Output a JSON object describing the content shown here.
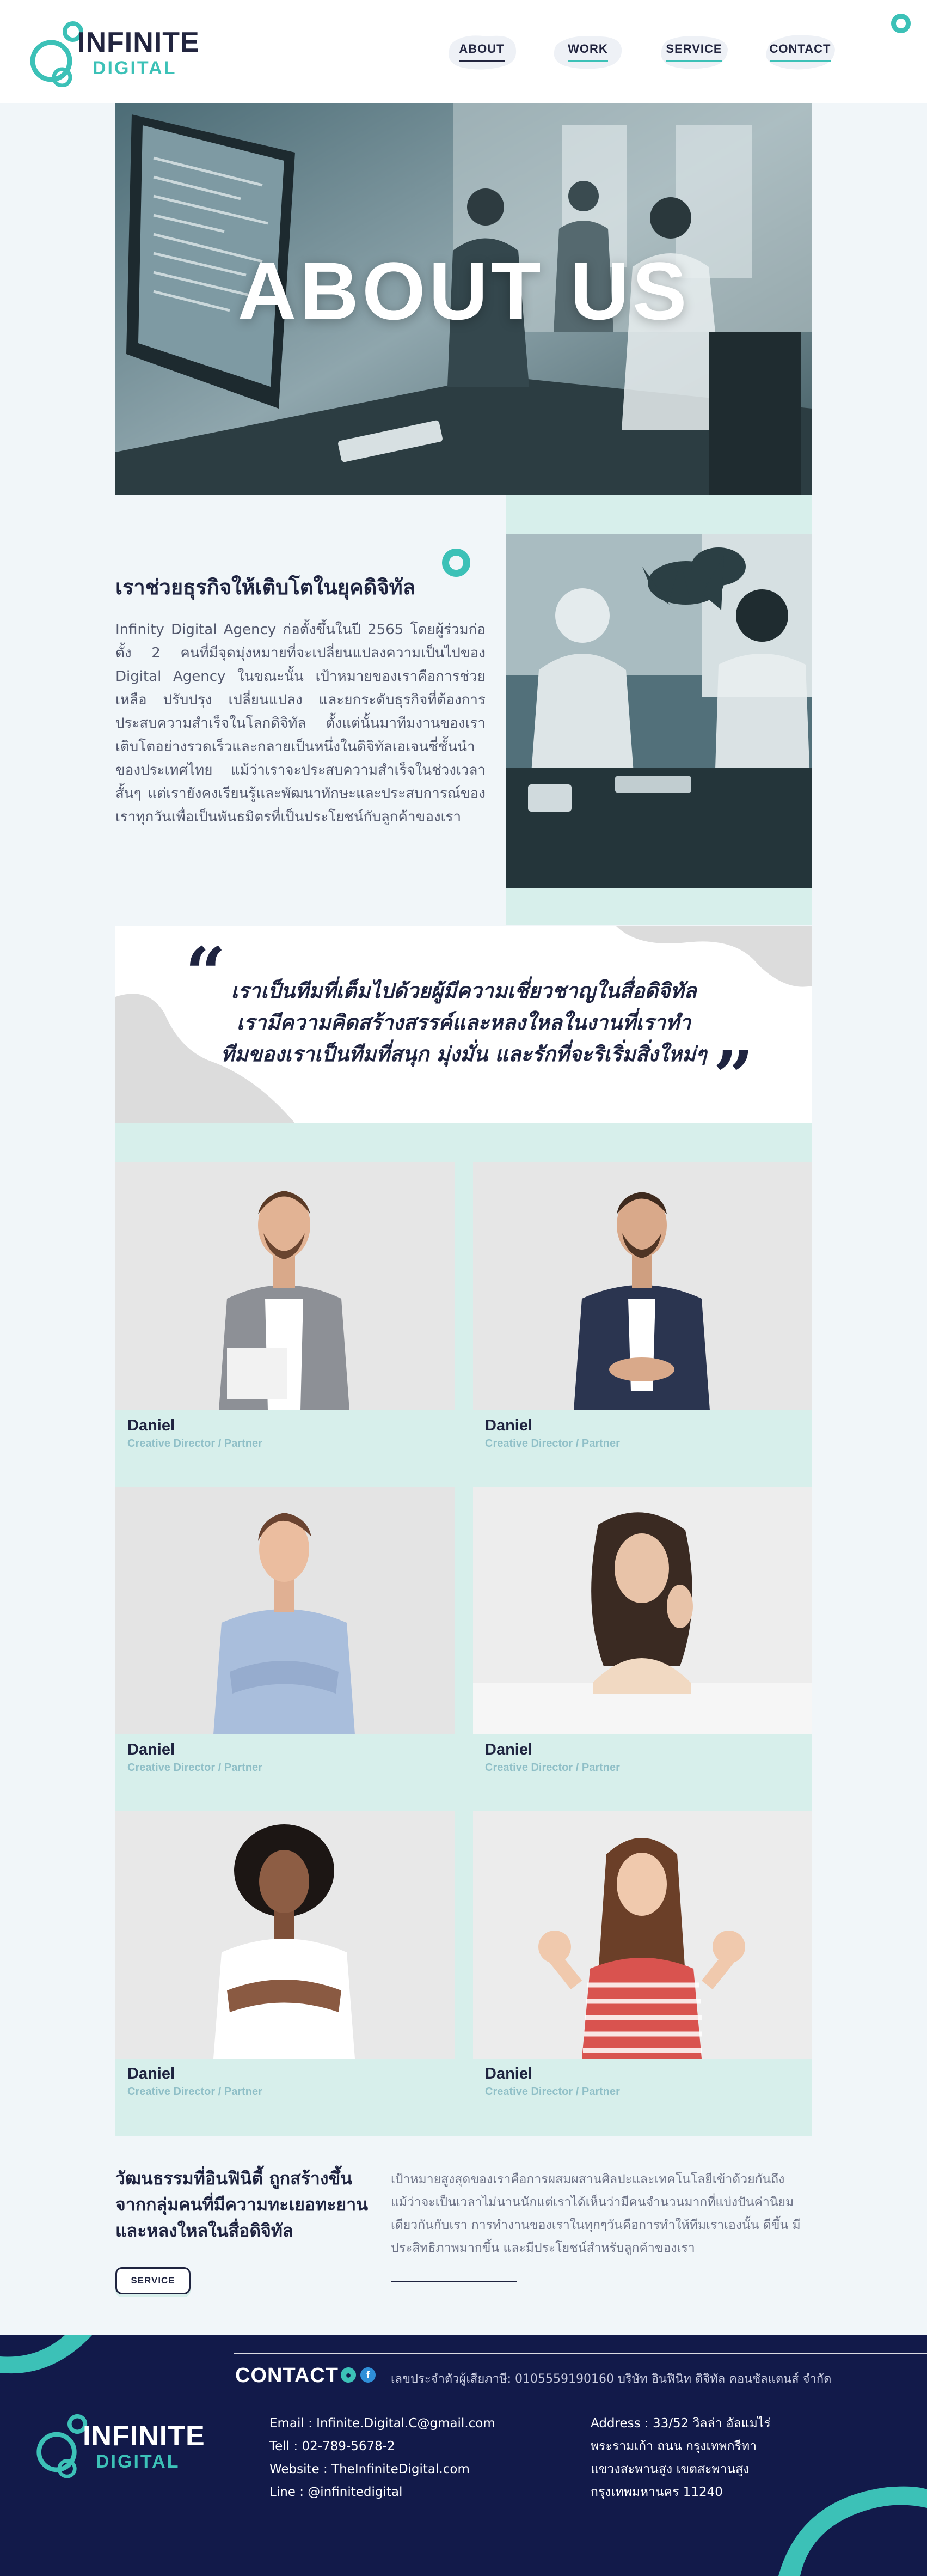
{
  "brand": {
    "name": "INFINITE",
    "tagline": "DIGITAL",
    "accent": "#3cc1b7",
    "navy": "#121a4a",
    "mint": "#d7efeb"
  },
  "nav": {
    "items": [
      {
        "label": "ABOUT",
        "active": true
      },
      {
        "label": "WORK",
        "active": false
      },
      {
        "label": "SERVICE",
        "active": false
      },
      {
        "label": "CONTACT",
        "active": false
      }
    ]
  },
  "hero": {
    "title": "ABOUT US"
  },
  "about": {
    "heading": "เราช่วยธุรกิจให้เติบโตในยุคดิจิทัล",
    "body": "Infinity Digital Agency ก่อตั้งขึ้นในปี 2565 โดยผู้ร่วมก่อตั้ง 2 คนที่มีจุดมุ่งหมายที่จะเปลี่ยนแปลงความเป็นไปของ Digital Agency ในขณะนั้น เป้าหมายของเราคือการช่วยเหลือ ปรับปรุง เปลี่ยนแปลง และยกระดับธุรกิจที่ต้องการประสบความสำเร็จในโลกดิจิทัล ตั้งแต่นั้นมาทีมงานของเราเติบโตอย่างรวดเร็วและกลายเป็นหนึ่งในดิจิทัลเอเจนซี่ชั้นนำของประเทศไทย แม้ว่าเราจะประสบความสำเร็จในช่วงเวลาสั้นๆ แต่เรายังคงเรียนรู้และพัฒนาทักษะและประสบการณ์ของเราทุกวันเพื่อเป็นพันธมิตรที่เป็นประโยชน์กับลูกค้าของเรา"
  },
  "quote": {
    "open": "“",
    "close": "”",
    "lines": [
      "เราเป็นทีมที่เต็มไปด้วยผู้มีความเชี่ยวชาญในสื่อดิจิทัล",
      "เรามีความคิดสร้างสรรค์และหลงใหลในงานที่เราทำ",
      "ทีมของเราเป็นทีมที่สนุก มุ่งมั่น และรักที่จะริเริ่มสิ่งใหม่ๆ"
    ]
  },
  "team": [
    {
      "name": "Daniel",
      "role": "Creative Director / Partner"
    },
    {
      "name": "Daniel",
      "role": "Creative Director / Partner"
    },
    {
      "name": "Daniel",
      "role": "Creative Director / Partner"
    },
    {
      "name": "Daniel",
      "role": "Creative Director / Partner"
    },
    {
      "name": "Daniel",
      "role": "Creative Director / Partner"
    },
    {
      "name": "Daniel",
      "role": "Creative Director / Partner"
    }
  ],
  "culture": {
    "title": "วัฒนธรรมที่อินฟินิตี้ ถูกสร้างขึ้นจากกลุ่มคนที่มีความทะเยอทะยาน และหลงใหลในสื่อดิจิทัล",
    "body": "เป้าหมายสูงสุดของเราคือการผสมผสานศิลปะและเทคโนโลยีเข้าด้วยกันถึงแม้ว่าจะเป็นเวลาไม่นานนักแต่เราได้เห็นว่ามีคนจำนวนมากที่แบ่งปันค่านิยมเดียวกันกับเรา การทำงานของเราในทุกๆวันคือการทำให้ทีมเราเองนั้น ดีขึ้น มีประสิทธิภาพมากขึ้น และมีประโยชน์สำหรับลูกค้าของเรา",
    "button": "SERVICE"
  },
  "footer": {
    "contact_title": "CONTACT",
    "registration": "เลขประจำตัวผู้เสียภาษี: 0105559190160 บริษัท อินฟินิท ดิจิทัล คอนซัลแตนส์ จำกัด",
    "left_lines": [
      "Email : Infinite.Digital.C@gmail.com",
      "Tell : 02-789-5678-2",
      "Website : TheInfiniteDigital.com",
      "Line : @infinitedigital"
    ],
    "right_lines": [
      "Address : 33/52 วิลล่า อัลแมไร่",
      "พระรามเก้า ถนน กรุงเทพกรีทา",
      "แขวงสะพานสูง เขตสะพานสูง",
      "กรุงเทพมหานคร 11240"
    ],
    "icons": [
      "line-icon",
      "facebook-icon"
    ]
  }
}
